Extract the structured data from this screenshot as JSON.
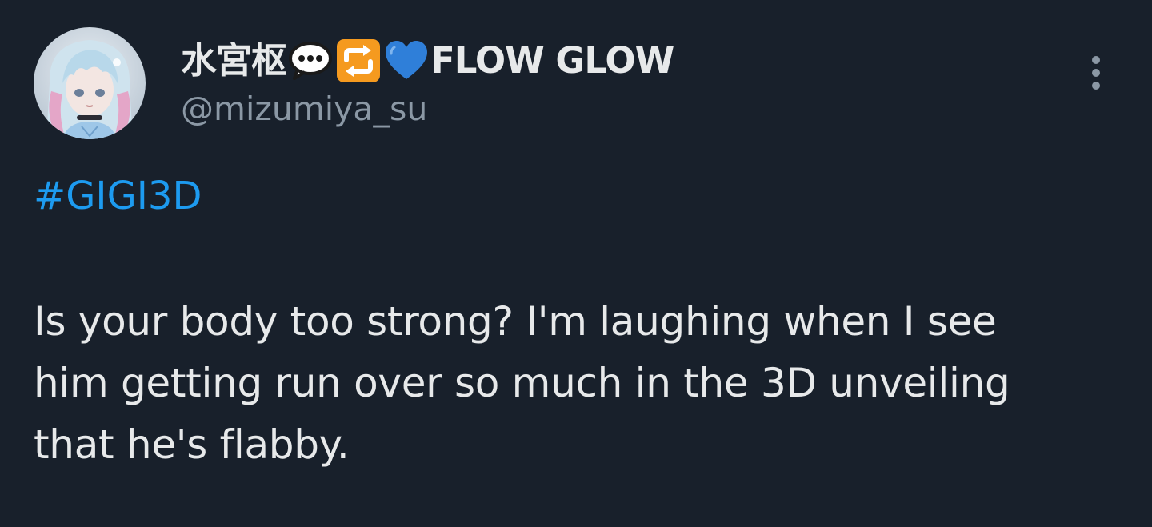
{
  "tweet": {
    "author": {
      "display_name": "水宮枢",
      "display_name_suffix": "FLOW GLOW",
      "name_emojis": [
        "speech-balloon-emoji",
        "repeat-button-emoji",
        "blue-heart-emoji"
      ],
      "handle": "@mizumiya_su",
      "avatar_icon": "anime-character-avatar"
    },
    "hashtag": "#GIGI3D",
    "text": "Is your body too strong? I'm laughing when I see\nhim getting run over so much in the 3D unveiling\nthat he's flabby.",
    "more_icon": "vertical-ellipsis-icon"
  },
  "colors": {
    "background": "#18202b",
    "text_primary": "#e7e9ea",
    "text_secondary": "#8b98a5",
    "accent": "#1d9bf0"
  }
}
